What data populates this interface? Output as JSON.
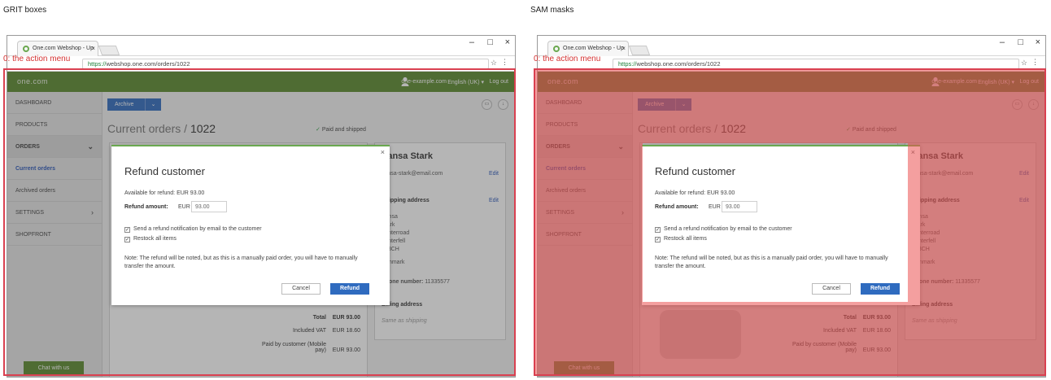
{
  "panels": {
    "left_caption": "GRIT boxes",
    "right_caption": "SAM masks"
  },
  "browser": {
    "tab_title": "One.com Webshop - Up",
    "tab_close": "×",
    "url_https": "https://",
    "url_rest": "webshop.one.com/orders/1022",
    "minimize": "–",
    "maximize": "□",
    "close": "×",
    "star": "☆",
    "menu": "⋮"
  },
  "annotation": {
    "label": "0: the action menu",
    "color": "#d94050"
  },
  "topnav": {
    "logo": "one.com",
    "user": "one-example.com",
    "language": "English (UK) ▾",
    "logout": "Log out",
    "color": "#5b8a2e"
  },
  "sidebar": {
    "items": [
      {
        "label": "DASHBOARD"
      },
      {
        "label": "PRODUCTS"
      },
      {
        "label": "ORDERS",
        "chevron": "⌄"
      },
      {
        "label": "Current orders"
      },
      {
        "label": "Archived orders"
      },
      {
        "label": "SETTINGS",
        "chevron": "›"
      },
      {
        "label": "SHOPFRONT"
      }
    ],
    "chat": "Chat with us"
  },
  "main": {
    "archive": "Archive",
    "archive_caret": "⌄",
    "title_prefix": "Current orders /",
    "title_id": "1022",
    "status": "Paid and shipped",
    "status_check": "✓",
    "customer_name": "Sansa Stark",
    "email": "sansa-stark@email.com",
    "edit": "Edit",
    "shipping_heading": "Shipping address",
    "address": [
      "Sansa",
      "Stark",
      "Winterroad",
      "Winterfell",
      "123CH"
    ],
    "country": "Denmark",
    "phone_label": "Phone number:",
    "phone": "11335577",
    "billing_heading": "Billing address",
    "billing_note": "Same as shipping",
    "totals": [
      {
        "label": "Total",
        "value": "EUR 93.00"
      },
      {
        "label": "Included VAT",
        "value": "EUR 18.60"
      },
      {
        "label": "Paid by customer (Mobile pay)",
        "value": "EUR 93.00"
      }
    ]
  },
  "modal": {
    "title": "Refund customer",
    "close": "×",
    "available": "Available for refund: EUR 93.00",
    "amount_label": "Refund amount:",
    "currency": "EUR",
    "amount_value": "93.00",
    "check_notify": "Send a refund notification by email to the customer",
    "check_restock": "Restock all items",
    "check_mark": "✓",
    "note": "Note: The refund will be noted, but as this is a manually paid order, you will have to manually transfer the amount.",
    "cancel": "Cancel",
    "refund": "Refund"
  }
}
